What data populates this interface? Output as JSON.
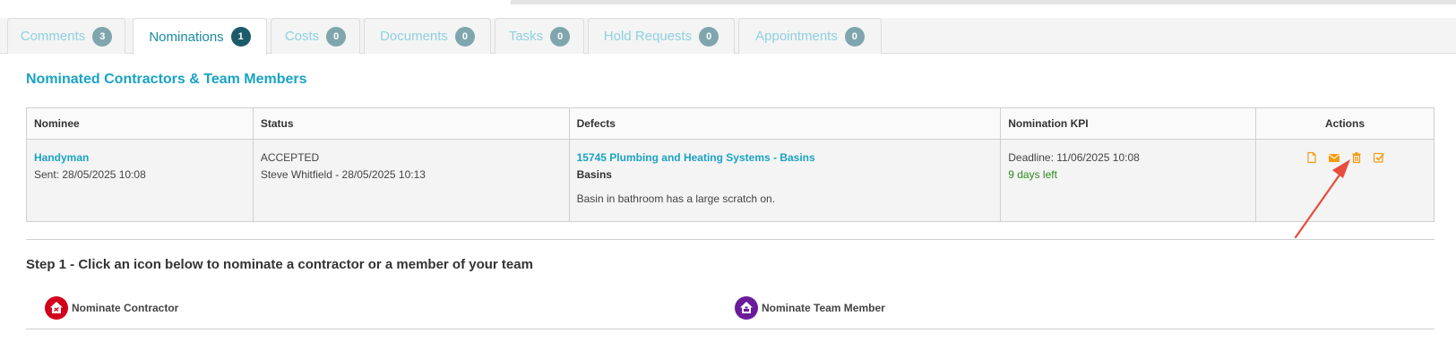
{
  "tabs": [
    {
      "label": "Comments",
      "count": "3"
    },
    {
      "label": "Nominations",
      "count": "1"
    },
    {
      "label": "Costs",
      "count": "0"
    },
    {
      "label": "Documents",
      "count": "0"
    },
    {
      "label": "Tasks",
      "count": "0"
    },
    {
      "label": "Hold Requests",
      "count": "0"
    },
    {
      "label": "Appointments",
      "count": "0"
    }
  ],
  "section_title": "Nominated Contractors & Team Members",
  "table": {
    "headers": [
      "Nominee",
      "Status",
      "Defects",
      "Nomination KPI",
      "Actions"
    ],
    "row": {
      "nominee": "Handyman",
      "sent": "Sent: 28/05/2025 10:08",
      "status": "ACCEPTED",
      "status_by": "Steve Whitfield - 28/05/2025 10:13",
      "defect_link": "15745 Plumbing and Heating Systems - Basins",
      "defect_name": "Basins",
      "defect_description": "Basin in bathroom has a large scratch on.",
      "deadline": "Deadline: 11/06/2025 10:08",
      "days_left": "9 days left",
      "action_icons": [
        "document-icon",
        "envelope-icon",
        "trash-icon",
        "check-square-icon"
      ]
    }
  },
  "step_title": "Step 1 - Click an icon below to nominate a contractor or a member of your team",
  "nominate_contractor": "Nominate Contractor",
  "nominate_team_member": "Nominate Team Member",
  "colors": {
    "accent": "#1aa3c4",
    "action_orange": "#f39c12",
    "contractor_red": "#d0021b",
    "team_purple": "#6a1b9a",
    "annotation_arrow": "#e74c3c"
  }
}
